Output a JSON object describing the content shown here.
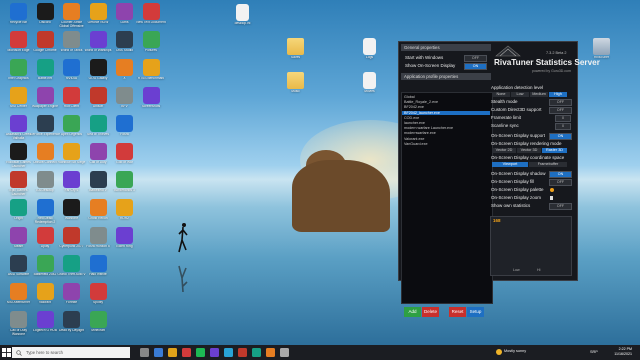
{
  "desktop": {
    "column1": [
      "Recycle Bin",
      "Microsoft Edge",
      "Intel Graphics",
      "MSI Center",
      "Assassin's Creed Valhalla",
      "Rockstar Games Launcher",
      "Epic Games Launcher",
      "Origin",
      "Steam",
      "AMD Software",
      "MSI Afterburner",
      "Call of Duty Warzone"
    ],
    "column2": [
      "Discord",
      "Google Chrome",
      "Battle.net",
      "Wallpaper Engine",
      "GeForce Experience",
      "Ubisoft Connect",
      "EA Desktop",
      "Red Dead Redemption 2",
      "Uplay",
      "Battlefield 2042",
      "Valorant",
      "Logitech G HUB"
    ],
    "column3": [
      "Counter-Strike Global Offensive",
      "World of Tanks",
      "NVIDIA",
      "Riot Client",
      "Apex Legends",
      "Rainbow Six Siege",
      "Far Cry 6",
      "Warzone",
      "Cyberpunk 2077",
      "Grand Theft Auto V",
      "Fortnite",
      "Dead by Daylight"
    ],
    "column4": [
      "Geforce NOW",
      "World of Warships",
      "GOG Galaxy",
      "Ubisoft",
      "Sea of Thieves",
      "Call of Duty",
      "Battlefield V",
      "Ghost Recon",
      "Forza Horizon 5",
      "Halo Infinite",
      "Spotify",
      "Minecraft"
    ],
    "column5": [
      "Lutris",
      "OBS Studio",
      "X",
      "BFV",
      "Forza",
      "God of War",
      "Borderlands 3",
      "RDR2",
      "Elden Ring"
    ],
    "column6": [
      "New Text Document",
      "Pictures",
      "RTSS Benchmark",
      "Screenshots"
    ],
    "files": [
      "desktop.ini",
      "Saves",
      "Logs",
      "Music",
      "Movies",
      "RivaTuner",
      "Temp"
    ]
  },
  "rtss": {
    "version": "7.3.2 Beta 2",
    "name": "RivaTuner Statistics Server",
    "powered": "powered by Guru3D.com",
    "general_header": "General properties",
    "start_with_windows": "Start with Windows",
    "show_osd": "Show On-Screen Display",
    "on": "ON",
    "off": "OFF",
    "profile_header": "Application profile properties",
    "profiles": [
      "Global",
      "Battle_Royale_2.exe",
      "BF2042.exe",
      "BF2042_launcher.exe",
      "COD.exe",
      "launcher.exe",
      "modern warfare Launcher.exe",
      "modernwarfare.exe",
      "Valorant.exe",
      "VanGuard.exe"
    ],
    "selected_profile": "BF2042_launcher.exe",
    "add": "Add",
    "delete": "Delete",
    "reset": "Reset",
    "setup": "Setup",
    "detection_label": "Application detection level",
    "detection": [
      "None",
      "Low",
      "Medium",
      "High"
    ],
    "stealth": "Stealth mode",
    "custom_d3d": "Custom Direct3D support",
    "framerate": "Framerate limit",
    "scanline": "Scanline sync",
    "osd_support": "On-Screen Display support",
    "rendering_mode": "On-Screen Display rendering mode",
    "render_opts": [
      "Vector 2D",
      "Vector 3D",
      "Raster 3D"
    ],
    "coord_space": "On-Screen Display coordinate space",
    "coord_opts": [
      "Viewport",
      "Framebuffer"
    ],
    "shadow": "On-Screen Display shadow",
    "fill": "On-Screen Display fill",
    "palette": "On-Screen Display palette",
    "zoom": "On-Screen Display zoom",
    "own_stats": "Show own statistics",
    "zero": "0",
    "stats_value": "168",
    "stats_left": "Low",
    "stats_right": "Hi"
  },
  "taskbar": {
    "search_placeholder": "Type here to search",
    "weather": "Mostly sunny",
    "time": "2:22 PM",
    "date": "11/16/2021",
    "language": "SRP"
  },
  "colors": {
    "accent": "#1e6fc2",
    "panel": "#16181d",
    "taskbar": "#1b1d22"
  }
}
